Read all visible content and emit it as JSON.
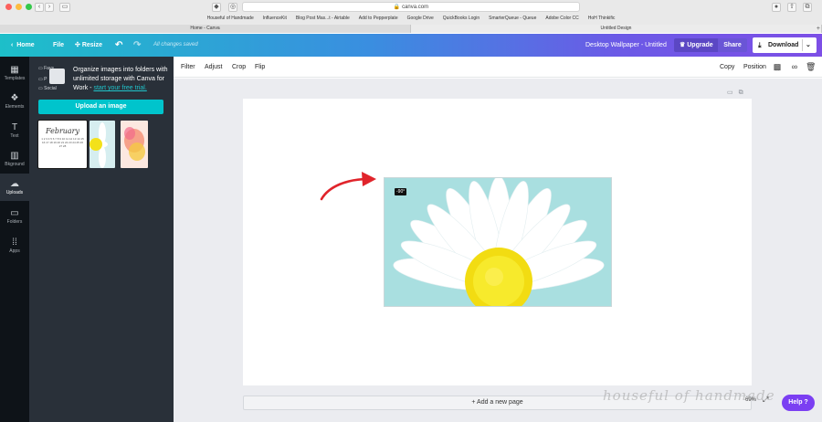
{
  "browser": {
    "url": "canva.com",
    "bookmarks": [
      "Houseful of Handmade",
      "InfluenceKit",
      "Blog Post Mas...t - Airtable",
      "Add to Pepperplate",
      "Google Drive",
      "QuickBooks Login",
      "SmarterQueue - Queue",
      "Adobe Color CC",
      "HoH Thinkific"
    ],
    "tabs": [
      "Home - Canva",
      "Untitled Design"
    ]
  },
  "topbar": {
    "home": "Home",
    "file": "File",
    "resize": "Resize",
    "saved_status": "All changes saved",
    "doc_title": "Desktop Wallpaper - Untitled",
    "upgrade": "Upgrade",
    "share": "Share",
    "download": "Download"
  },
  "rail": [
    {
      "label": "Templates",
      "icon": "templates-icon"
    },
    {
      "label": "Elements",
      "icon": "elements-icon"
    },
    {
      "label": "Text",
      "icon": "text-icon"
    },
    {
      "label": "Bkground",
      "icon": "background-icon"
    },
    {
      "label": "Uploads",
      "icon": "upload-icon"
    },
    {
      "label": "Folders",
      "icon": "folder-icon"
    },
    {
      "label": "Apps",
      "icon": "apps-icon"
    }
  ],
  "panel": {
    "folders": [
      "Favs",
      "P",
      "Social"
    ],
    "organize_text": "Organize images into folders with unlimited storage with Canva for Work - ",
    "trial_link": "start your free trial.",
    "upload_button": "Upload an image",
    "thumb_title": "February",
    "thumb_calendar": "1 2 3 4 5 6 7 8 9 10 11 12 13 14 15 16 17 18 19 20 21 22 23 24 25 26 27 28"
  },
  "toolbar": {
    "filter": "Filter",
    "adjust": "Adjust",
    "crop": "Crop",
    "flip": "Flip",
    "copy": "Copy",
    "position": "Position"
  },
  "editor": {
    "rotation_badge": "-90°",
    "add_page": "+ Add a new page",
    "zoom": "69%",
    "help": "Help ?",
    "watermark": "houseful of handmade"
  },
  "colors": {
    "accent_teal": "#00c4cc",
    "arrow_red": "#e0242b",
    "help_purple": "#7b3ff2"
  }
}
